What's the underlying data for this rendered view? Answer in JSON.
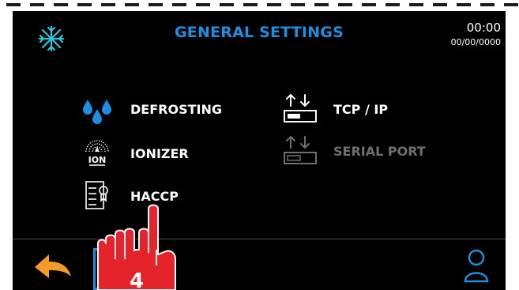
{
  "header": {
    "title": "GENERAL SETTINGS",
    "time": "00:00",
    "date": "00/00/0000"
  },
  "menu": {
    "defrosting": "DEFROSTING",
    "ionizer": "IONIZER",
    "ionizer_icon_text": "ION",
    "haccp": "HACCP",
    "tcp_ip": "TCP / IP",
    "serial_port": "SERIAL PORT"
  },
  "overlay": {
    "step_number": "4"
  },
  "colors": {
    "accent": "#1e8fe0",
    "back_arrow": "#f39a2b",
    "hand": "#e5232b",
    "disabled": "#6f6f6f"
  },
  "icons": [
    "snowflake-icon",
    "water-drops-icon",
    "ionizer-icon",
    "haccp-document-icon",
    "tcp-ip-icon",
    "serial-port-icon",
    "back-arrow-icon",
    "user-icon",
    "pointing-hand-icon"
  ]
}
